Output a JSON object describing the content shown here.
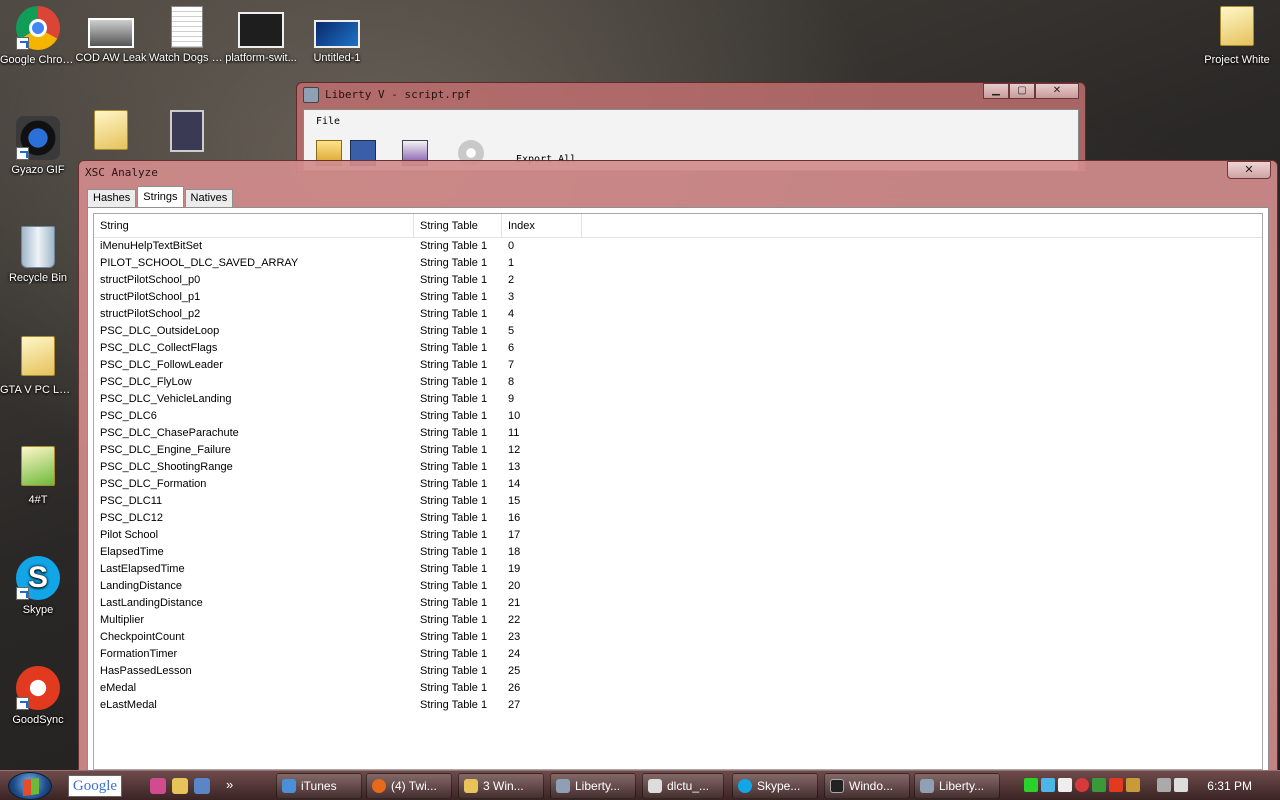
{
  "desktop": {
    "icons": [
      {
        "label": "Google Chrome",
        "icon": "chrome-icon"
      },
      {
        "label": "COD AW Leak",
        "icon": "image-thumbnail-icon"
      },
      {
        "label": "Watch Dogs Shit",
        "icon": "text-file-icon"
      },
      {
        "label": "platform-swit...",
        "icon": "image-thumbnail-icon"
      },
      {
        "label": "Untitled-1",
        "icon": "image-thumbnail-icon"
      },
      {
        "label": "Project White",
        "icon": "folder-icon"
      },
      {
        "label": "Gyazo GIF",
        "icon": "camera-icon"
      },
      {
        "label": "Recycle Bin",
        "icon": "recycle-bin-icon"
      },
      {
        "label": "GTA V PC Leaks",
        "icon": "folder-icon"
      },
      {
        "label": "4#T",
        "icon": "folder-icon"
      },
      {
        "label": "Skype",
        "icon": "skype-icon"
      },
      {
        "label": "GoodSync",
        "icon": "goodsync-icon"
      }
    ]
  },
  "back_window": {
    "title": "Liberty V - script.rpf",
    "menu_file": "File",
    "export_all": "Export All",
    "minimize": "▁",
    "maximize": "▢",
    "close": "✕"
  },
  "main_window": {
    "title": "XSC Analyze",
    "close": "✕",
    "tabs": [
      {
        "label": "Hashes",
        "active": false
      },
      {
        "label": "Strings",
        "active": true
      },
      {
        "label": "Natives",
        "active": false
      }
    ],
    "columns": [
      "String",
      "String Table",
      "Index"
    ],
    "rows": [
      [
        "iMenuHelpTextBitSet",
        "String Table 1",
        "0"
      ],
      [
        "PILOT_SCHOOL_DLC_SAVED_ARRAY",
        "String Table 1",
        "1"
      ],
      [
        "structPilotSchool_p0",
        "String Table 1",
        "2"
      ],
      [
        "structPilotSchool_p1",
        "String Table 1",
        "3"
      ],
      [
        "structPilotSchool_p2",
        "String Table 1",
        "4"
      ],
      [
        "PSC_DLC_OutsideLoop",
        "String Table 1",
        "5"
      ],
      [
        "PSC_DLC_CollectFlags",
        "String Table 1",
        "6"
      ],
      [
        "PSC_DLC_FollowLeader",
        "String Table 1",
        "7"
      ],
      [
        "PSC_DLC_FlyLow",
        "String Table 1",
        "8"
      ],
      [
        "PSC_DLC_VehicleLanding",
        "String Table 1",
        "9"
      ],
      [
        "PSC_DLC6",
        "String Table 1",
        "10"
      ],
      [
        "PSC_DLC_ChaseParachute",
        "String Table 1",
        "11"
      ],
      [
        "PSC_DLC_Engine_Failure",
        "String Table 1",
        "12"
      ],
      [
        "PSC_DLC_ShootingRange",
        "String Table 1",
        "13"
      ],
      [
        "PSC_DLC_Formation",
        "String Table 1",
        "14"
      ],
      [
        "PSC_DLC11",
        "String Table 1",
        "15"
      ],
      [
        "PSC_DLC12",
        "String Table 1",
        "16"
      ],
      [
        "Pilot School",
        "String Table 1",
        "17"
      ],
      [
        "ElapsedTime",
        "String Table 1",
        "18"
      ],
      [
        "LastElapsedTime",
        "String Table 1",
        "19"
      ],
      [
        "LandingDistance",
        "String Table 1",
        "20"
      ],
      [
        "LastLandingDistance",
        "String Table 1",
        "21"
      ],
      [
        "Multiplier",
        "String Table 1",
        "22"
      ],
      [
        "CheckpointCount",
        "String Table 1",
        "23"
      ],
      [
        "FormationTimer",
        "String Table 1",
        "24"
      ],
      [
        "HasPassedLesson",
        "String Table 1",
        "25"
      ],
      [
        "eMedal",
        "String Table 1",
        "26"
      ],
      [
        "eLastMedal",
        "String Table 1",
        "27"
      ]
    ]
  },
  "taskbar": {
    "google_label": "Google",
    "overflow": "»",
    "buttons": [
      {
        "label": "iTunes",
        "color": "#4a90d9"
      },
      {
        "label": "(4) Twi...",
        "color": "#e66a1c"
      },
      {
        "label": "3 Win...",
        "color": "#e8c35a"
      },
      {
        "label": "Liberty...",
        "color": "#8fa0b4"
      },
      {
        "label": "dlctu_...",
        "color": "#dddddd"
      },
      {
        "label": "Skype...",
        "color": "#12a5e8"
      },
      {
        "label": "Windo...",
        "color": "#222222"
      },
      {
        "label": "Liberty...",
        "color": "#8fa0b4"
      }
    ],
    "clock": "6:31 PM"
  }
}
